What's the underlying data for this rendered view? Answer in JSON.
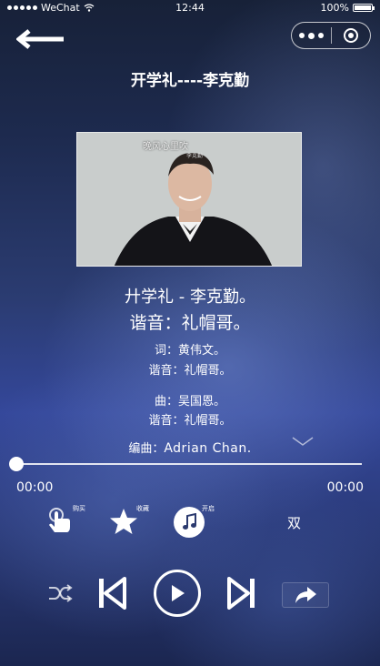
{
  "status_bar": {
    "carrier": "WeChat",
    "time": "12:44",
    "battery": "100%"
  },
  "page": {
    "title": "开学礼----李克勤"
  },
  "cover": {
    "caption": "晚风心里吹",
    "subcaption": "李克勤"
  },
  "lyrics": {
    "line1": "廾学礼 - 李克勤。",
    "line2": "谐音：礼帽哥。",
    "line3": "词：黄伟文。",
    "line4": "谐音：礼帽哥。",
    "line5": "曲：吴国恩。",
    "line6": "谐音：礼帽哥。",
    "line7_label": "编曲：",
    "line7_value": "Adrian Chan."
  },
  "progress": {
    "current": "00:00",
    "total": "00:00",
    "fraction": 0
  },
  "actions": {
    "buy_label": "购买",
    "fav_label": "收藏",
    "open_label": "开启",
    "mode_label": "双"
  },
  "icons": [
    "back-arrow-icon",
    "more-icon",
    "record-icon",
    "chevron-down-icon",
    "tap-icon",
    "star-icon",
    "music-note-icon",
    "shuffle-icon",
    "prev-icon",
    "play-icon",
    "next-icon",
    "share-icon"
  ]
}
